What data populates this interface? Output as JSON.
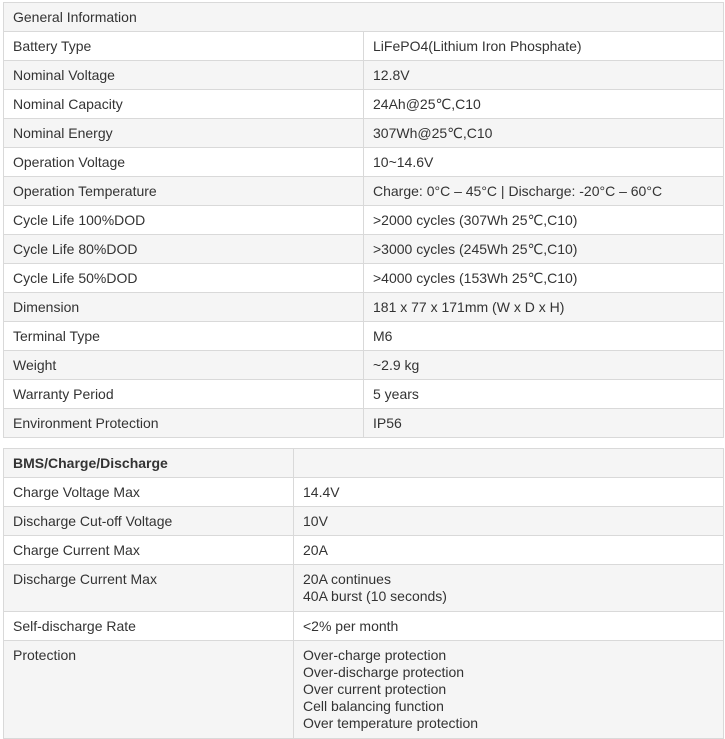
{
  "general": {
    "header": "General Information",
    "rows": [
      {
        "label": "Battery Type",
        "value": "LiFePO4(Lithium Iron Phosphate)"
      },
      {
        "label": "Nominal Voltage",
        "value": "12.8V"
      },
      {
        "label": "Nominal Capacity",
        "value": "24Ah@25℃,C10"
      },
      {
        "label": "Nominal Energy",
        "value": "307Wh@25℃,C10"
      },
      {
        "label": "Operation Voltage",
        "value": "10~14.6V"
      },
      {
        "label": "Operation Temperature",
        "value": "Charge: 0°C – 45°C | Discharge: -20°C – 60°C"
      },
      {
        "label": "Cycle Life 100%DOD",
        "value": ">2000 cycles (307Wh 25℃,C10)"
      },
      {
        "label": "Cycle Life 80%DOD",
        "value": ">3000 cycles (245Wh 25℃,C10)"
      },
      {
        "label": "Cycle Life 50%DOD",
        "value": ">4000 cycles (153Wh 25℃,C10)"
      },
      {
        "label": "Dimension",
        "value": "181 x 77 x 171mm (W x D x H)"
      },
      {
        "label": "Terminal Type",
        "value": "M6"
      },
      {
        "label": "Weight",
        "value": "~2.9 kg"
      },
      {
        "label": "Warranty Period",
        "value": "5 years"
      },
      {
        "label": "Environment Protection",
        "value": "IP56"
      }
    ]
  },
  "bms": {
    "header": "BMS/Charge/Discharge",
    "rows": [
      {
        "label": "Charge Voltage Max",
        "value": "14.4V"
      },
      {
        "label": "Discharge Cut-off Voltage",
        "value": "10V"
      },
      {
        "label": "Charge Current Max",
        "value": "20A"
      },
      {
        "label": "Discharge Current Max",
        "lines": [
          "20A continues",
          "40A burst (10 seconds)"
        ]
      },
      {
        "label": "Self-discharge Rate",
        "value": "<2% per month"
      },
      {
        "label": "Protection",
        "lines": [
          "Over-charge protection",
          "Over-discharge protection",
          "Over current protection",
          "Cell balancing function",
          "Over temperature protection"
        ]
      }
    ]
  }
}
